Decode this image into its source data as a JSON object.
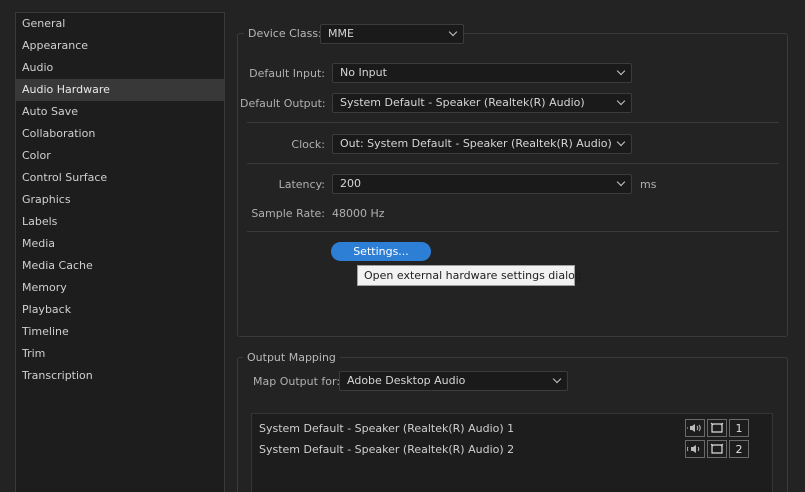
{
  "sidebar": {
    "items": [
      {
        "label": "General"
      },
      {
        "label": "Appearance"
      },
      {
        "label": "Audio"
      },
      {
        "label": "Audio Hardware",
        "selected": true
      },
      {
        "label": "Auto Save"
      },
      {
        "label": "Collaboration"
      },
      {
        "label": "Color"
      },
      {
        "label": "Control Surface"
      },
      {
        "label": "Graphics"
      },
      {
        "label": "Labels"
      },
      {
        "label": "Media"
      },
      {
        "label": "Media Cache"
      },
      {
        "label": "Memory"
      },
      {
        "label": "Playback"
      },
      {
        "label": "Timeline"
      },
      {
        "label": "Trim"
      },
      {
        "label": "Transcription"
      }
    ]
  },
  "device": {
    "class_label": "Device Class:",
    "class_value": "MME",
    "default_input_label": "Default Input:",
    "default_input_value": "No Input",
    "default_output_label": "Default Output:",
    "default_output_value": "System Default - Speaker (Realtek(R) Audio)",
    "clock_label": "Clock:",
    "clock_value": "Out: System Default - Speaker (Realtek(R) Audio)",
    "latency_label": "Latency:",
    "latency_value": "200",
    "latency_unit": "ms",
    "sample_rate_label": "Sample Rate:",
    "sample_rate_value": "48000 Hz",
    "settings_button": "Settings...",
    "tooltip": "Open external hardware settings dialog"
  },
  "output_mapping": {
    "title": "Output Mapping",
    "map_for_label": "Map Output for:",
    "map_for_value": "Adobe Desktop Audio",
    "rows": [
      {
        "label": "System Default - Speaker (Realtek(R) Audio) 1",
        "channel": "1"
      },
      {
        "label": "System Default - Speaker (Realtek(R) Audio) 2",
        "channel": "2"
      }
    ]
  },
  "colors": {
    "accent": "#2d7fd6",
    "background": "#232323",
    "sidebar_bg": "#1d1d1d",
    "selected_bg": "#383838"
  },
  "icons": [
    "chevron-down-icon",
    "speaker-icon",
    "stereo-bracket-icon"
  ]
}
